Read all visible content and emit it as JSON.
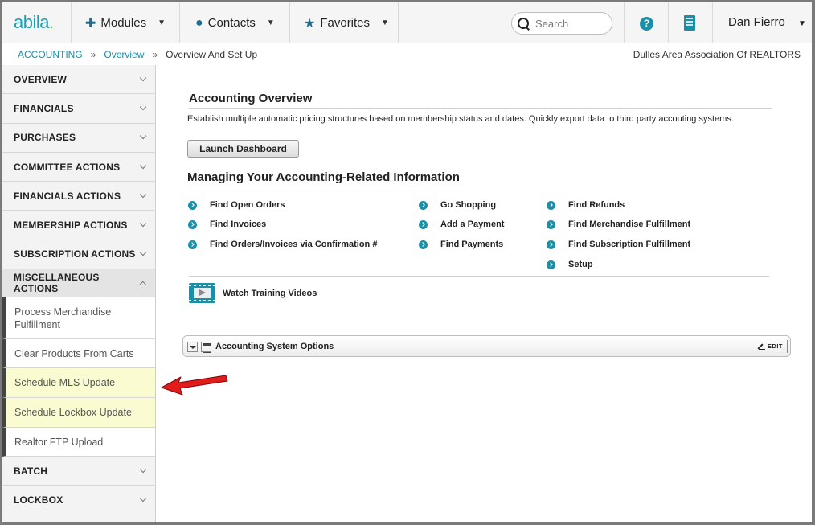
{
  "logo": {
    "text": "abila",
    "dot": "."
  },
  "topnav": {
    "modules": "Modules",
    "contacts": "Contacts",
    "favorites": "Favorites",
    "search_placeholder": "Search",
    "user_name": "Dan Fierro",
    "modules_icon": "puzzle-icon",
    "contacts_icon": "person-icon",
    "favorites_icon": "star-icon",
    "help_label": "?"
  },
  "breadcrumb": {
    "items": [
      "ACCOUNTING",
      "Overview",
      "Overview And Set Up"
    ],
    "separator": "»",
    "organization": "Dulles Area Association Of REALTORS"
  },
  "sidebar": {
    "sections_top": [
      "OVERVIEW",
      "FINANCIALS",
      "PURCHASES",
      "COMMITTEE ACTIONS",
      "FINANCIALS ACTIONS",
      "MEMBERSHIP ACTIONS",
      "SUBSCRIPTION ACTIONS"
    ],
    "open_section": "MISCELLANEOUS ACTIONS",
    "sub_items": [
      {
        "label": "Process Merchandise Fulfillment",
        "highlighted": false
      },
      {
        "label": "Clear Products From Carts",
        "highlighted": false
      },
      {
        "label": "Schedule MLS Update",
        "highlighted": true
      },
      {
        "label": "Schedule Lockbox Update",
        "highlighted": true
      },
      {
        "label": "Realtor FTP Upload",
        "highlighted": false
      }
    ],
    "sections_bottom": [
      "BATCH",
      "LOCKBOX"
    ]
  },
  "main": {
    "overview_title": "Accounting Overview",
    "overview_desc": "Establish multiple automatic pricing structures based on membership status and dates. Quickly export data to third party accouting systems.",
    "launch_button": "Launch Dashboard",
    "manage_title": "Managing Your Accounting-Related Information",
    "links_col1": [
      "Find Open Orders",
      "Find Invoices",
      "Find Orders/Invoices via Confirmation #"
    ],
    "links_col2": [
      "Go Shopping",
      "Add a Payment",
      "Find Payments"
    ],
    "links_col3": [
      "Find Refunds",
      "Find Merchandise Fulfillment",
      "Find Subscription Fulfillment",
      "Setup"
    ],
    "video_label": "Watch Training Videos"
  },
  "panel": {
    "title": "Accounting System Options",
    "edit_label": "EDIT"
  },
  "colors": {
    "accent": "#1b8fa8",
    "highlight": "#fbfbd2",
    "arrow": "#e21b1b"
  }
}
